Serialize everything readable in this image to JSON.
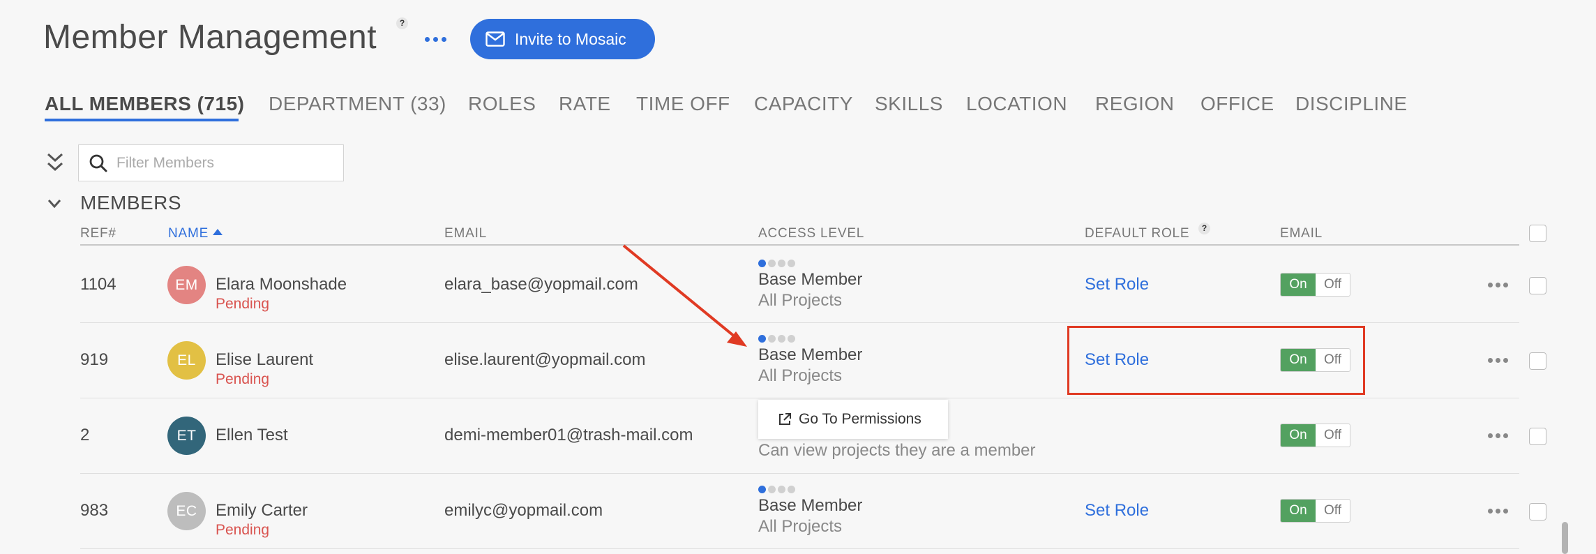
{
  "page": {
    "title": "Member Management",
    "help_badge": "?",
    "invite_label": "Invite to Mosaic",
    "icons": {
      "title_more": "more-horizontal-icon",
      "invite": "mail-icon",
      "collapse_all": "double-chevron-down-icon",
      "filter": "search-icon",
      "section_toggle": "chevron-down-icon",
      "permissions": "external-link-icon",
      "row_more": "more-horizontal-icon"
    },
    "colors": {
      "accent": "#2f6fdc",
      "pending": "#d9534f",
      "toggle_on": "#53a160",
      "annotation": "#e03a23"
    }
  },
  "tabs": [
    {
      "label": "ALL MEMBERS (715)",
      "active": true
    },
    {
      "label": "DEPARTMENT (33)"
    },
    {
      "label": "ROLES"
    },
    {
      "label": "RATE"
    },
    {
      "label": "TIME OFF"
    },
    {
      "label": "CAPACITY"
    },
    {
      "label": "SKILLS"
    },
    {
      "label": "LOCATION"
    },
    {
      "label": "REGION"
    },
    {
      "label": "OFFICE"
    },
    {
      "label": "DISCIPLINE"
    }
  ],
  "filter": {
    "placeholder": "Filter Members",
    "value": ""
  },
  "section": {
    "title": "MEMBERS"
  },
  "columns": {
    "ref": "REF#",
    "name": "NAME",
    "email": "EMAIL",
    "access": "ACCESS LEVEL",
    "default_role": "DEFAULT ROLE",
    "email_notify": "EMAIL",
    "sort": "name-ascending"
  },
  "members": [
    {
      "ref": "1104",
      "initials": "EM",
      "avatar_color": "#e38482",
      "name": "Elara Moonshade",
      "status": "Pending",
      "email": "elara_base@yopmail.com",
      "access_level": "Base Member",
      "access_dots_filled": 1,
      "scope": "All Projects",
      "role_action": "Set Role",
      "toggle_on": "On",
      "toggle_off": "Off",
      "email_enabled": true
    },
    {
      "ref": "919",
      "initials": "EL",
      "avatar_color": "#e2c044",
      "name": "Elise Laurent",
      "status": "Pending",
      "email": "elise.laurent@yopmail.com",
      "access_level": "Base Member",
      "access_dots_filled": 1,
      "scope": "All Projects",
      "role_action": "Set Role",
      "toggle_on": "On",
      "toggle_off": "Off",
      "email_enabled": true
    },
    {
      "ref": "2",
      "initials": "ET",
      "avatar_color": "#32667a",
      "name": "Ellen Test",
      "email": "demi-member01@trash-mail.com",
      "toggle_on": "On",
      "toggle_off": "Off",
      "email_enabled": true
    },
    {
      "ref": "983",
      "initials": "EC",
      "avatar_color": "#bdbdbd",
      "name": "Emily Carter",
      "status": "Pending",
      "email": "emilyc@yopmail.com",
      "access_level": "Base Member",
      "access_dots_filled": 1,
      "scope": "All Projects",
      "role_action": "Set Role",
      "toggle_on": "On",
      "toggle_off": "Off",
      "email_enabled": true
    }
  ],
  "permissions_popup": {
    "label": "Go To Permissions",
    "description": "Can view projects they are a member"
  }
}
